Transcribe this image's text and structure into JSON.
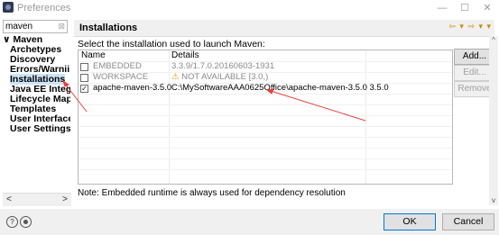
{
  "window": {
    "title": "Preferences",
    "min": "—",
    "max": "☐",
    "close": "✕"
  },
  "filter": {
    "value": "maven",
    "clear_icon": "⊠"
  },
  "tree": {
    "items": [
      {
        "label": "∨ Maven",
        "indent": 0,
        "selected": false
      },
      {
        "label": "Archetypes",
        "indent": 1,
        "selected": false
      },
      {
        "label": "Discovery",
        "indent": 1,
        "selected": false
      },
      {
        "label": "Errors/Warnii",
        "indent": 1,
        "selected": false
      },
      {
        "label": "Installations",
        "indent": 1,
        "selected": true
      },
      {
        "label": "Java EE Integr",
        "indent": 1,
        "selected": false
      },
      {
        "label": "Lifecycle Map",
        "indent": 1,
        "selected": false
      },
      {
        "label": "Templates",
        "indent": 1,
        "selected": false
      },
      {
        "label": "User Interface",
        "indent": 1,
        "selected": false
      },
      {
        "label": "User Settings",
        "indent": 1,
        "selected": false
      }
    ],
    "scroll_left": "<",
    "scroll_right": ">"
  },
  "page": {
    "title": "Installations",
    "nav": "⇦ ▾ ⇨ ▾ ▾",
    "instruction": "Select the installation used to launch Maven:",
    "columns": {
      "name": "Name",
      "details": "Details"
    },
    "rows": [
      {
        "checked": false,
        "name": "EMBEDDED",
        "details": "3.3.9/1.7.0.20160603-1931",
        "style": "grey",
        "warn": ""
      },
      {
        "checked": false,
        "name": "WORKSPACE",
        "details": "NOT AVAILABLE [3.0,)",
        "style": "grey",
        "warn": "⚠"
      },
      {
        "checked": true,
        "name": "apache-maven-3.5.0",
        "details": "C:\\MySoftwareAAA0625Office\\apache-maven-3.5.0 3.5.0",
        "style": "normal",
        "warn": ""
      }
    ],
    "buttons": {
      "add": "Add...",
      "edit": "Edit...",
      "remove": "Remove"
    },
    "note": "Note: Embedded runtime is always used for dependency resolution",
    "scroll_up": "^",
    "scroll_down": "v"
  },
  "dialog": {
    "help": "?",
    "ok": "OK",
    "cancel": "Cancel"
  },
  "colors": {
    "selection": "#cce4f7",
    "annotation": "#e8413c",
    "accent": "#0078d7"
  }
}
